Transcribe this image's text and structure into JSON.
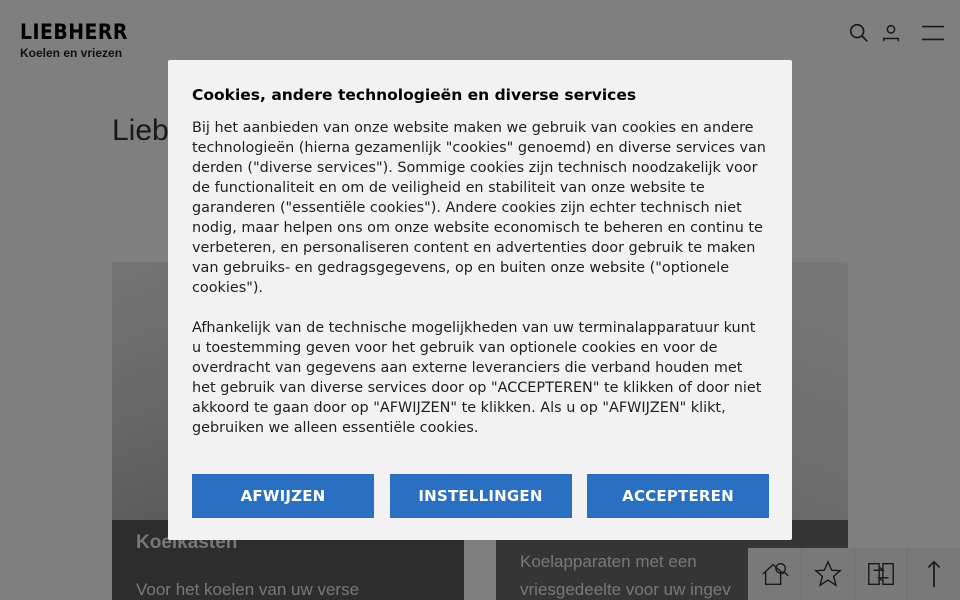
{
  "header": {
    "logo": "LIEBHERR",
    "tagline": "Koelen en vriezen",
    "icons": [
      "search-icon",
      "user-icon",
      "menu-icon"
    ]
  },
  "main": {
    "heading": "Liebh",
    "cards": [
      {
        "title": "Koelkasten",
        "text": "Voor het koelen van uw verse"
      },
      {
        "title": "",
        "text_line1": "Koelapparaten met een",
        "text_line2": "vriesgedeelte voor uw ingev"
      }
    ]
  },
  "toolbar": {
    "icons": [
      "dealer-search-icon",
      "star-icon",
      "compare-icon",
      "arrow-up-icon"
    ]
  },
  "cookie_modal": {
    "title": "Cookies, andere technologieën en diverse services",
    "paragraph1_lines": [
      "Bij het aanbieden van onze website maken we gebruik van cookies en andere",
      "technologieën (hierna gezamenlijk \"cookies\" genoemd) en diverse services van",
      "derden (\"diverse services\"). Sommige cookies zijn technisch noodzakelijk voor",
      "de functionaliteit en om de veiligheid en stabiliteit van onze website te",
      "garanderen (\"essentiële cookies\"). Andere cookies zijn echter technisch niet",
      "nodig, maar helpen ons om onze website economisch te beheren en continu te",
      "verbeteren, en personaliseren content en advertenties door gebruik te maken",
      "van gebruiks- en gedragsgegevens, op en buiten onze website (\"optionele",
      "cookies\")."
    ],
    "paragraph2_lines": [
      "Afhankelijk van de technische mogelijkheden van uw terminalapparatuur kunt",
      "u toestemming geven voor het gebruik van optionele cookies en voor de",
      "overdracht van gegevens aan externe leveranciers die verband houden met",
      "het gebruik van diverse services door op \"ACCEPTEREN\" te klikken of door niet",
      "akkoord te gaan door op \"AFWIJZEN\" te klikken. Als u op \"AFWIJZEN\" klikt,",
      "gebruiken we alleen essentiële cookies."
    ],
    "buttons": {
      "reject": "AFWIJZEN",
      "settings": "INSTELLINGEN",
      "accept": "ACCEPTEREN"
    },
    "accent_color": "#2a70c2"
  }
}
